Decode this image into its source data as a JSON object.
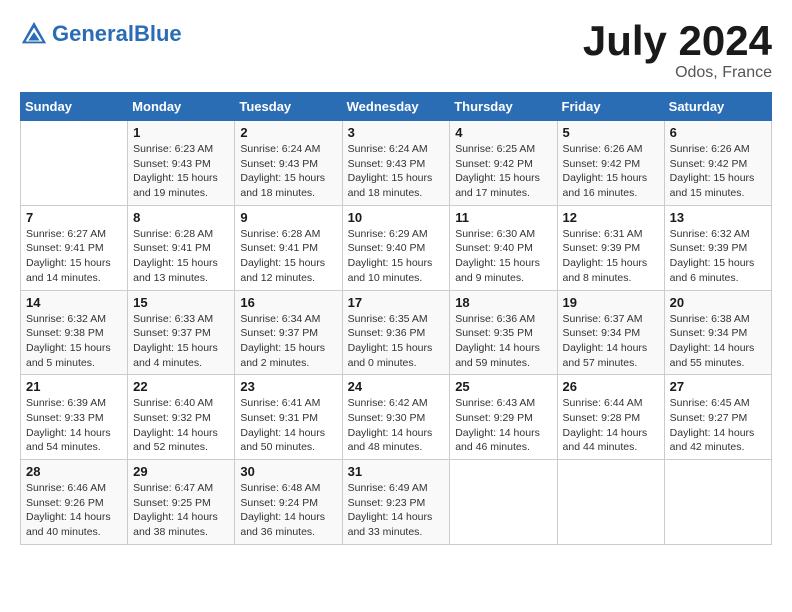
{
  "header": {
    "logo_general": "General",
    "logo_blue": "Blue",
    "month_title": "July 2024",
    "location": "Odos, France"
  },
  "days_of_week": [
    "Sunday",
    "Monday",
    "Tuesday",
    "Wednesday",
    "Thursday",
    "Friday",
    "Saturday"
  ],
  "weeks": [
    [
      {
        "day": "",
        "info": ""
      },
      {
        "day": "1",
        "info": "Sunrise: 6:23 AM\nSunset: 9:43 PM\nDaylight: 15 hours\nand 19 minutes."
      },
      {
        "day": "2",
        "info": "Sunrise: 6:24 AM\nSunset: 9:43 PM\nDaylight: 15 hours\nand 18 minutes."
      },
      {
        "day": "3",
        "info": "Sunrise: 6:24 AM\nSunset: 9:43 PM\nDaylight: 15 hours\nand 18 minutes."
      },
      {
        "day": "4",
        "info": "Sunrise: 6:25 AM\nSunset: 9:42 PM\nDaylight: 15 hours\nand 17 minutes."
      },
      {
        "day": "5",
        "info": "Sunrise: 6:26 AM\nSunset: 9:42 PM\nDaylight: 15 hours\nand 16 minutes."
      },
      {
        "day": "6",
        "info": "Sunrise: 6:26 AM\nSunset: 9:42 PM\nDaylight: 15 hours\nand 15 minutes."
      }
    ],
    [
      {
        "day": "7",
        "info": "Sunrise: 6:27 AM\nSunset: 9:41 PM\nDaylight: 15 hours\nand 14 minutes."
      },
      {
        "day": "8",
        "info": "Sunrise: 6:28 AM\nSunset: 9:41 PM\nDaylight: 15 hours\nand 13 minutes."
      },
      {
        "day": "9",
        "info": "Sunrise: 6:28 AM\nSunset: 9:41 PM\nDaylight: 15 hours\nand 12 minutes."
      },
      {
        "day": "10",
        "info": "Sunrise: 6:29 AM\nSunset: 9:40 PM\nDaylight: 15 hours\nand 10 minutes."
      },
      {
        "day": "11",
        "info": "Sunrise: 6:30 AM\nSunset: 9:40 PM\nDaylight: 15 hours\nand 9 minutes."
      },
      {
        "day": "12",
        "info": "Sunrise: 6:31 AM\nSunset: 9:39 PM\nDaylight: 15 hours\nand 8 minutes."
      },
      {
        "day": "13",
        "info": "Sunrise: 6:32 AM\nSunset: 9:39 PM\nDaylight: 15 hours\nand 6 minutes."
      }
    ],
    [
      {
        "day": "14",
        "info": "Sunrise: 6:32 AM\nSunset: 9:38 PM\nDaylight: 15 hours\nand 5 minutes."
      },
      {
        "day": "15",
        "info": "Sunrise: 6:33 AM\nSunset: 9:37 PM\nDaylight: 15 hours\nand 4 minutes."
      },
      {
        "day": "16",
        "info": "Sunrise: 6:34 AM\nSunset: 9:37 PM\nDaylight: 15 hours\nand 2 minutes."
      },
      {
        "day": "17",
        "info": "Sunrise: 6:35 AM\nSunset: 9:36 PM\nDaylight: 15 hours\nand 0 minutes."
      },
      {
        "day": "18",
        "info": "Sunrise: 6:36 AM\nSunset: 9:35 PM\nDaylight: 14 hours\nand 59 minutes."
      },
      {
        "day": "19",
        "info": "Sunrise: 6:37 AM\nSunset: 9:34 PM\nDaylight: 14 hours\nand 57 minutes."
      },
      {
        "day": "20",
        "info": "Sunrise: 6:38 AM\nSunset: 9:34 PM\nDaylight: 14 hours\nand 55 minutes."
      }
    ],
    [
      {
        "day": "21",
        "info": "Sunrise: 6:39 AM\nSunset: 9:33 PM\nDaylight: 14 hours\nand 54 minutes."
      },
      {
        "day": "22",
        "info": "Sunrise: 6:40 AM\nSunset: 9:32 PM\nDaylight: 14 hours\nand 52 minutes."
      },
      {
        "day": "23",
        "info": "Sunrise: 6:41 AM\nSunset: 9:31 PM\nDaylight: 14 hours\nand 50 minutes."
      },
      {
        "day": "24",
        "info": "Sunrise: 6:42 AM\nSunset: 9:30 PM\nDaylight: 14 hours\nand 48 minutes."
      },
      {
        "day": "25",
        "info": "Sunrise: 6:43 AM\nSunset: 9:29 PM\nDaylight: 14 hours\nand 46 minutes."
      },
      {
        "day": "26",
        "info": "Sunrise: 6:44 AM\nSunset: 9:28 PM\nDaylight: 14 hours\nand 44 minutes."
      },
      {
        "day": "27",
        "info": "Sunrise: 6:45 AM\nSunset: 9:27 PM\nDaylight: 14 hours\nand 42 minutes."
      }
    ],
    [
      {
        "day": "28",
        "info": "Sunrise: 6:46 AM\nSunset: 9:26 PM\nDaylight: 14 hours\nand 40 minutes."
      },
      {
        "day": "29",
        "info": "Sunrise: 6:47 AM\nSunset: 9:25 PM\nDaylight: 14 hours\nand 38 minutes."
      },
      {
        "day": "30",
        "info": "Sunrise: 6:48 AM\nSunset: 9:24 PM\nDaylight: 14 hours\nand 36 minutes."
      },
      {
        "day": "31",
        "info": "Sunrise: 6:49 AM\nSunset: 9:23 PM\nDaylight: 14 hours\nand 33 minutes."
      },
      {
        "day": "",
        "info": ""
      },
      {
        "day": "",
        "info": ""
      },
      {
        "day": "",
        "info": ""
      }
    ]
  ]
}
